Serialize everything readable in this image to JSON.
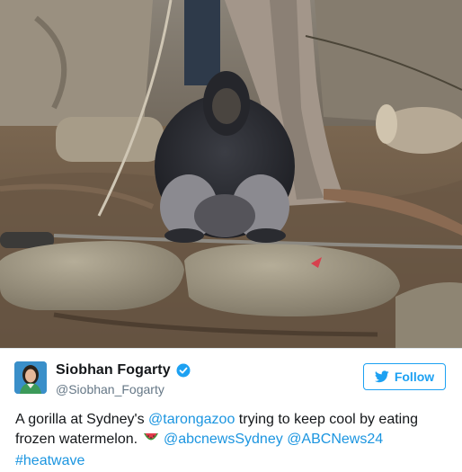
{
  "photo": {
    "alt_subject": "gorilla-photo"
  },
  "author": {
    "display_name": "Siobhan Fogarty",
    "handle": "@Siobhan_Fogarty",
    "verified": true
  },
  "follow_button": {
    "label": "Follow"
  },
  "tweet": {
    "text_1": "A gorilla at Sydney's ",
    "mention_1": "@tarongazoo",
    "text_2": " trying to keep cool by eating frozen watermelon. ",
    "emoji_name": "watermelon-emoji",
    "text_3": " ",
    "mention_2": "@abcnewsSydney",
    "text_4": " ",
    "mention_3": "@ABCNews24",
    "hashtag": "#heatwave"
  },
  "colors": {
    "link": "#1b95e0",
    "follow": "#1da1f2",
    "name": "#14171a",
    "handle": "#657786"
  }
}
